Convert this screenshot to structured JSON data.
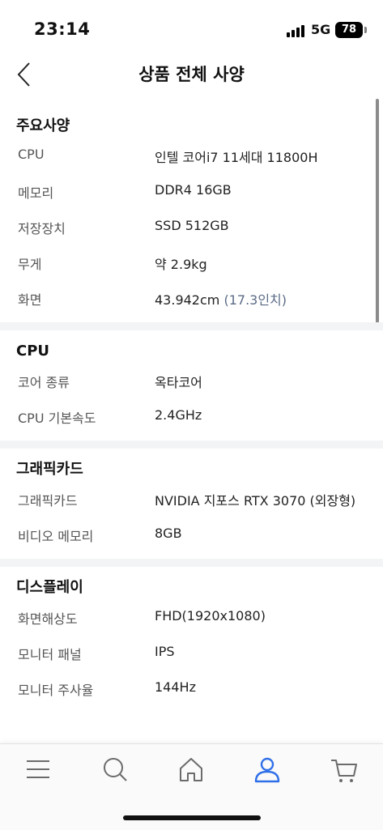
{
  "status": {
    "time": "23:14",
    "network": "5G",
    "battery": "78"
  },
  "header": {
    "title": "상품 전체 사양"
  },
  "sections": {
    "main": {
      "title": "주요사양",
      "rows": [
        {
          "label": "CPU",
          "value": "인텔 코어i7 11세대 11800H"
        },
        {
          "label": "메모리",
          "value": "DDR4 16GB"
        },
        {
          "label": "저장장치",
          "value": "SSD 512GB"
        },
        {
          "label": "무게",
          "value": "약 2.9kg"
        },
        {
          "label": "화면",
          "value": "43.942cm",
          "sub": "(17.3인치)"
        }
      ]
    },
    "cpu": {
      "title": "CPU",
      "rows": [
        {
          "label": "코어 종류",
          "value": "옥타코어"
        },
        {
          "label": "CPU 기본속도",
          "value": "2.4GHz"
        }
      ]
    },
    "graphics": {
      "title": "그래픽카드",
      "rows": [
        {
          "label": "그래픽카드",
          "value": "NVIDIA 지포스 RTX 3070 (외장형)"
        },
        {
          "label": "비디오 메모리",
          "value": "8GB"
        }
      ]
    },
    "display": {
      "title": "디스플레이",
      "rows": [
        {
          "label": "화면해상도",
          "value": "FHD(1920x1080)"
        },
        {
          "label": "모니터 패널",
          "value": "IPS"
        },
        {
          "label": "모니터 주사율",
          "value": "144Hz"
        }
      ]
    }
  },
  "nav": {
    "items": [
      {
        "icon": "menu-icon"
      },
      {
        "icon": "search-icon"
      },
      {
        "icon": "home-icon"
      },
      {
        "icon": "user-icon",
        "active": true
      },
      {
        "icon": "cart-icon"
      }
    ],
    "active_color": "#2f6fe8",
    "icon_color": "#6b6b6b"
  }
}
